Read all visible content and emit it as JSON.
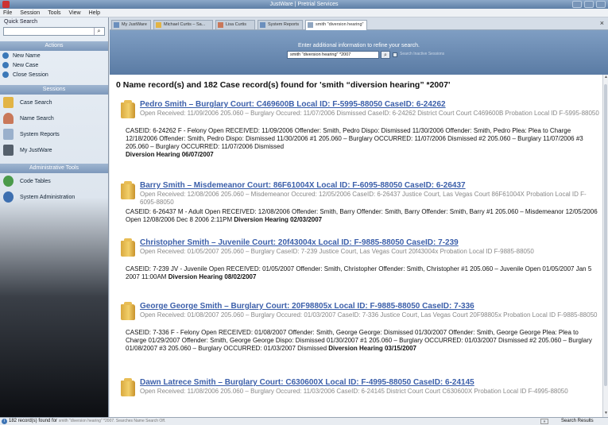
{
  "window": {
    "title": "JustWare | Pretrial Services"
  },
  "menu": [
    "File",
    "Session",
    "Tools",
    "View",
    "Help"
  ],
  "sidebar": {
    "quick_search_label": "Quick Search",
    "quick_search_value": "",
    "actions_header": "Actions",
    "actions": [
      "New Name",
      "New Case",
      "Close Session"
    ],
    "sessions_header": "Sessions",
    "sessions": [
      "Case Search",
      "Name Search",
      "System Reports",
      "My JustWare"
    ],
    "admin_header": "Administrative Tools",
    "admin": [
      "Code Tables",
      "System Administration"
    ]
  },
  "tabs": [
    {
      "label": "My JustWare"
    },
    {
      "label": "Michael Curtis – Sa..."
    },
    {
      "label": "Lisa Curtis"
    },
    {
      "label": "System Reports"
    },
    {
      "label": "smith \"diversion hearing\""
    }
  ],
  "tab_close": "×",
  "refine": {
    "message": "Enter additional information to refine your search.",
    "query": "smith \"diversion hearing\" *2007",
    "checkbox_label": "Search Inactive Sessions"
  },
  "results": {
    "summary": "0 Name record(s) and 182 Case record(s) found for 'smith “diversion hearing” *2007'",
    "records": [
      {
        "title": "Pedro Smith – Burglary Court: C469600B Local ID: F-5995-88050 CaseID: 6-24262",
        "meta": "Open Received: 11/09/2006 205.060 – Burglary Occured: 11/07/2006 Dismissed CaseID: 6-24262 District Court Court C469600B Probation Local ID F-5995-88050",
        "detail": "CASEID: 6-24262 F - Felony Open RECEIVED: 11/09/2006 Offender: Smith, Pedro Dispo: Dismissed 11/30/2006 Offender: Smith, Pedro Plea: Plea to Charge 12/18/2006 Offender: Smith, Pedro Dispo: Dismissed 11/30/2006 #1 205.060 – Burglary OCCURRED: 11/07/2006 Dismissed #2 205.060 – Burglary 11/07/2006 #3 205.060 – Burglary OCCURRED: 11/07/2006 Dismissed",
        "hearing": "Diversion Hearing 06/07/2007"
      },
      {
        "title": "Barry Smith – Misdemeanor Court: 86F61004X Local ID: F-6095-88050 CaseID: 6-26437",
        "meta": "Open Received: 12/08/2006 205.060 – Misdemeanor Occured: 12/05/2006 CaseID: 6-26437 Justice Court, Las Vegas Court 86F61004X Probation Local ID F-6095-88050",
        "detail": "CASEID: 6-26437 M - Adult Open RECEIVED: 12/08/2006 Offender: Smith, Barry Offender: Smith, Barry Offender: Smith, Barry #1 205.060 – Misdemeanor 12/05/2006 Open 12/08/2006 Dec 8 2006 2:11PM",
        "hearing": "Diversion Hearing 02/03/2007"
      },
      {
        "title": "Christopher Smith – Juvenile Court: 20f43004x Local ID: F-9885-88050 CaseID: 7-239",
        "meta": "Open Received: 01/05/2007 205.060 – Burglary CaseID: 7-239 Justice Court, Las Vegas Court 20f43004x Probation Local ID F-9885-88050",
        "detail": "CASEID: 7-239 JV - Juvenile Open RECEIVED: 01/05/2007 Offender: Smith, Christopher Offender: Smith, Christopher #1 205.060 – Juvenile Open 01/05/2007 Jan 5 2007 11:00AM",
        "hearing": "Diversion Hearing 08/02/2007"
      },
      {
        "title": "George George Smith – Burglary Court: 20F98805x Local ID: F-9885-88050 CaseID: 7-336",
        "meta": "Open Received: 01/08/2007 205.060 – Burglary Occured: 01/03/2007 CaseID: 7-336 Justice Court, Las Vegas Court 20F98805x Probation Local ID F-9885-88050",
        "detail": "CASEID: 7-336 F - Felony Open RECEIVED: 01/08/2007 Offender: Smith, George George: Dismissed 01/30/2007 Offender: Smith, George George Plea: Plea to Charge 01/29/2007 Offender: Smith, George George Dispo: Dismissed 01/30/2007 #1 205.060 – Burglary OCCURRED: 01/03/2007 Dismissed #2 205.060 – Burglary 01/08/2007 #3 205.060 – Burglary OCCURRED: 01/03/2007 Dismissed",
        "hearing": "Diversion Hearing 03/15/2007"
      },
      {
        "title": "Dawn Latrece Smith – Burglary Court: C630600X Local ID: F-4995-88050 CaseID: 6-24145",
        "meta": "Open Received: 11/08/2006 205.060 – Burglary Occured: 11/03/2006 CaseID: 6-24145 District Court Court C630600X Probation Local ID F-4995-88050",
        "detail": "",
        "hearing": ""
      }
    ]
  },
  "status": {
    "count_text": "182 record(s) found for",
    "sub_text": "smith \"diversion hearing\" *2007. Searches Name Search Off.",
    "nav_label": "»",
    "panel_label": "Search Results"
  }
}
